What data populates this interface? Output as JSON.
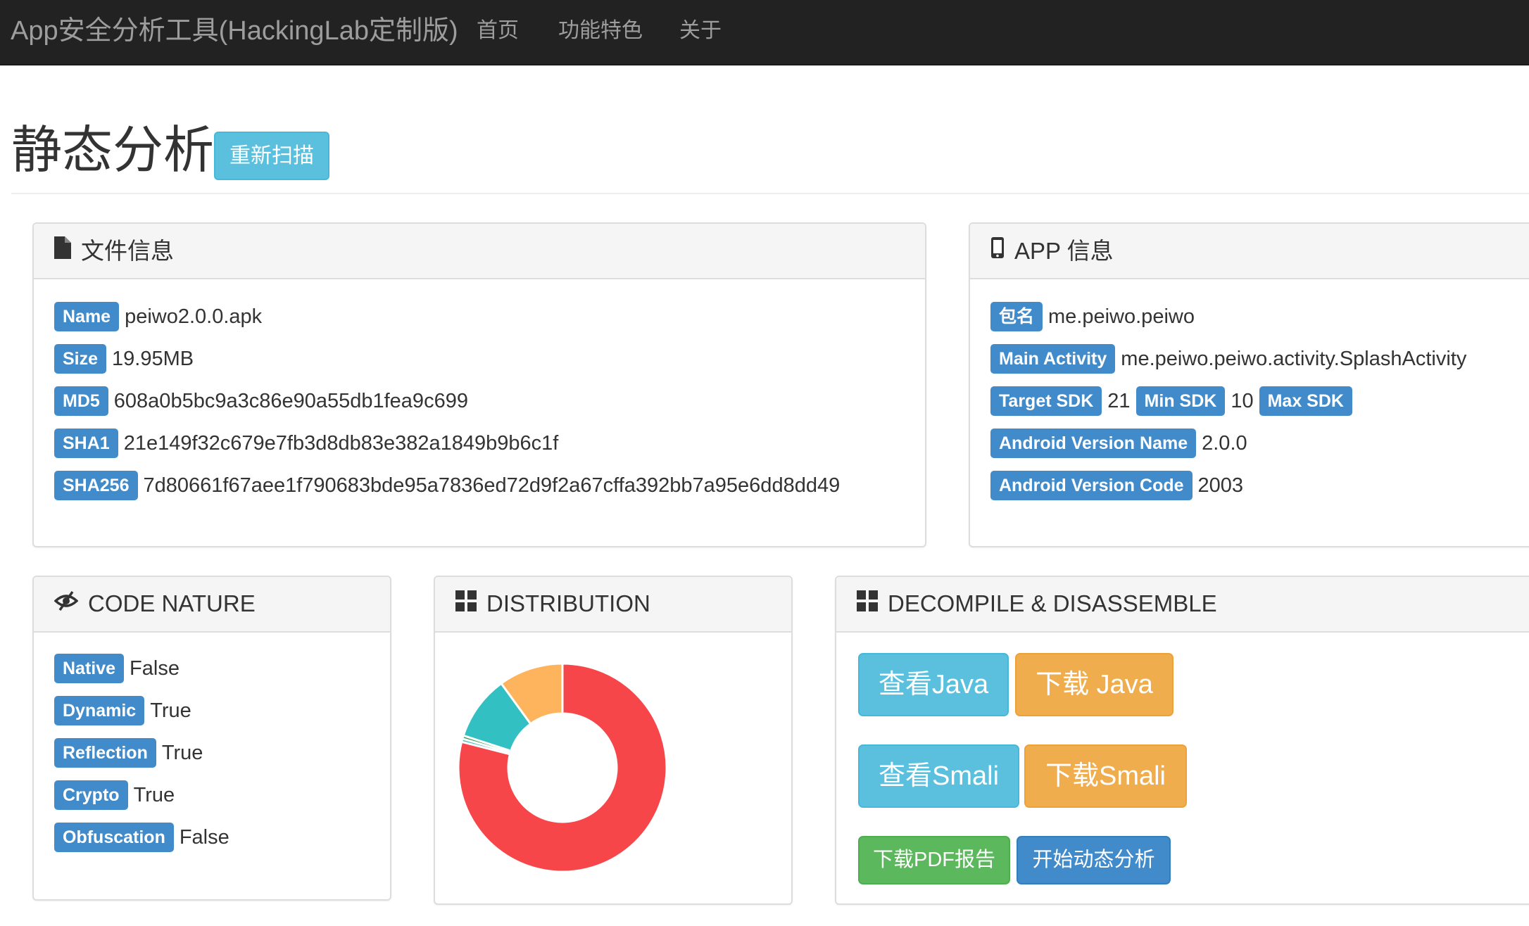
{
  "navbar": {
    "brand": "App安全分析工具(HackingLab定制版)",
    "links": [
      "首页",
      "功能特色",
      "关于"
    ]
  },
  "header": {
    "title": "静态分析",
    "rescan_label": "重新扫描"
  },
  "file_info": {
    "title": "文件信息",
    "icon": "file-icon",
    "rows": [
      {
        "label": "Name",
        "value": "peiwo2.0.0.apk"
      },
      {
        "label": "Size",
        "value": "19.95MB"
      },
      {
        "label": "MD5",
        "value": "608a0b5bc9a3c86e90a55db1fea9c699"
      },
      {
        "label": "SHA1",
        "value": "21e149f32c679e7fb3d8db83e382a1849b9b6c1f"
      },
      {
        "label": "SHA256",
        "value": "7d80661f67aee1f790683bde95a7836ed72d9f2a67cffa392bb7a95e6dd8dd49"
      }
    ]
  },
  "app_info": {
    "title": "APP 信息",
    "icon": "phone-icon",
    "package_label": "包名",
    "package_value": "me.peiwo.peiwo",
    "main_activity_label": "Main Activity",
    "main_activity_value": "me.peiwo.peiwo.activity.SplashActivity",
    "target_sdk_label": "Target SDK",
    "target_sdk_value": "21",
    "min_sdk_label": "Min SDK",
    "min_sdk_value": "10",
    "max_sdk_label": "Max SDK",
    "max_sdk_value": "",
    "version_name_label": "Android Version Name",
    "version_name_value": "2.0.0",
    "version_code_label": "Android Version Code",
    "version_code_value": "2003"
  },
  "code_nature": {
    "title": "CODE NATURE",
    "icon": "eye-slash-icon",
    "rows": [
      {
        "label": "Native",
        "value": "False"
      },
      {
        "label": "Dynamic",
        "value": "True"
      },
      {
        "label": "Reflection",
        "value": "True"
      },
      {
        "label": "Crypto",
        "value": "True"
      },
      {
        "label": "Obfuscation",
        "value": "False"
      }
    ]
  },
  "distribution": {
    "title": "DISTRIBUTION",
    "icon": "grid-icon"
  },
  "decompile": {
    "title": "DECOMPILE & DISASSEMBLE",
    "icon": "grid-icon",
    "view_java": "查看Java",
    "download_java": "下载 Java",
    "view_smali": "查看Smali",
    "download_smali": "下载Smali",
    "download_pdf": "下载PDF报告",
    "start_dynamic": "开始动态分析"
  },
  "chart_data": {
    "type": "pie",
    "donut": true,
    "slices": [
      {
        "value": 79.0,
        "color": "#f7464a"
      },
      {
        "value": 0.5,
        "color": "#46bfbd"
      },
      {
        "value": 0.5,
        "color": "#2e9b4a"
      },
      {
        "value": 10.0,
        "color": "#33c0c3"
      },
      {
        "value": 10.0,
        "color": "#fdb45c"
      }
    ]
  }
}
